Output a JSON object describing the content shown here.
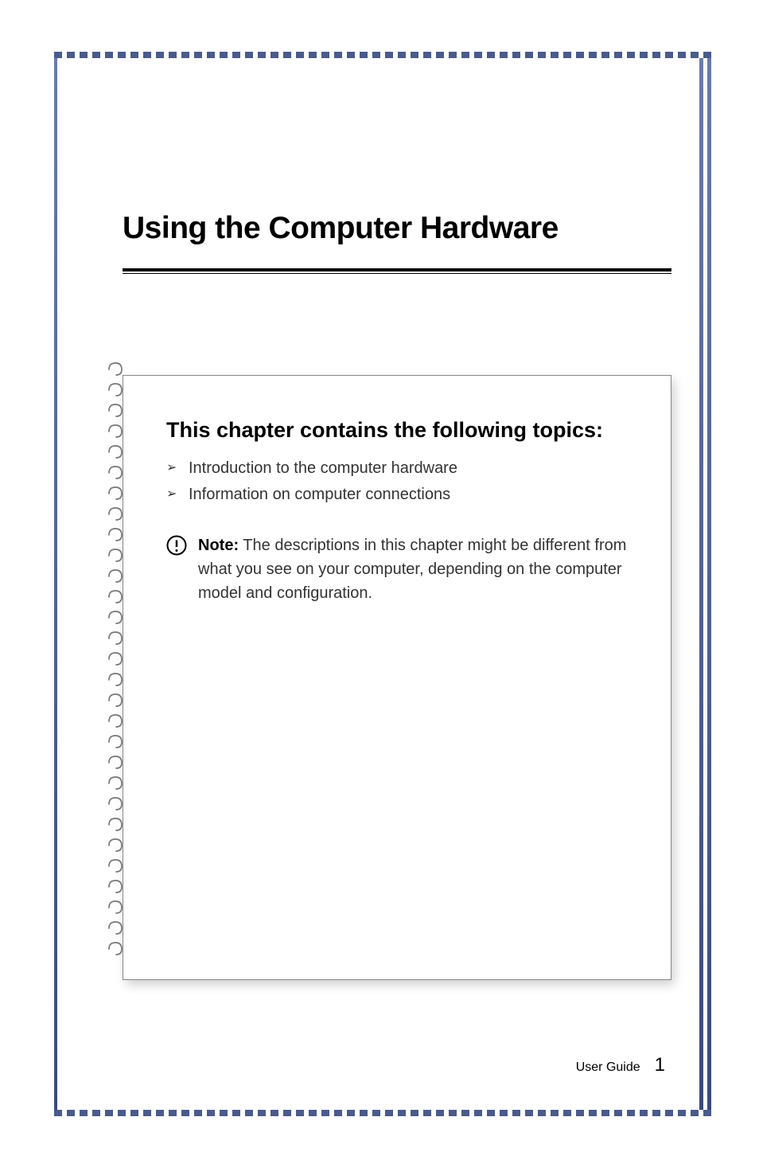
{
  "chapter": {
    "title": "Using the Computer Hardware"
  },
  "infobox": {
    "heading": "This chapter contains the following topics:",
    "topics": [
      "Introduction to the computer hardware",
      "Information on computer connections"
    ],
    "note": {
      "label": "Note:",
      "text": " The descriptions in this chapter might be different from what you see on your computer, depending on the computer model and configuration."
    }
  },
  "footer": {
    "label": "User Guide",
    "page": "1"
  }
}
